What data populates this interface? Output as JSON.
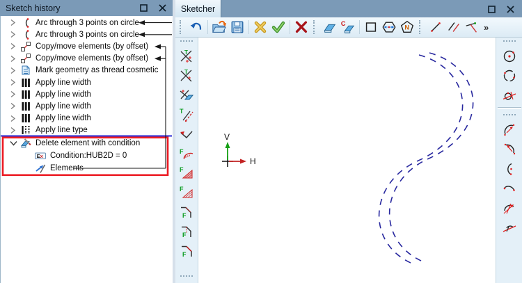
{
  "colors": {
    "titlebar_bg": "#7b9ab7",
    "vtoolbar_bg": "#e4f0f8",
    "highlight_red": "#ec1c24",
    "selection_blue": "#2b2bd5",
    "curve_blue": "#28289f",
    "axis_v_green": "#16a015",
    "axis_h_red": "#c32222"
  },
  "left_panel": {
    "title": "Sketch history",
    "window_buttons": [
      "maximize-icon",
      "close-icon"
    ],
    "tree": {
      "items": [
        {
          "label": "Arc through 3 points on circle",
          "icon": "arc-3-points-icon",
          "state": "collapsed",
          "annotated": true
        },
        {
          "label": "Arc through 3 points on circle",
          "icon": "arc-3-points-icon",
          "state": "collapsed",
          "annotated": true
        },
        {
          "label": "Copy/move elements (by offset)",
          "icon": "copy-move-offset-icon",
          "state": "collapsed",
          "annotated": true
        },
        {
          "label": "Copy/move elements (by offset)",
          "icon": "copy-move-offset-icon",
          "state": "collapsed",
          "annotated": true
        },
        {
          "label": "Mark geometry as thread cosmetic",
          "icon": "thread-cosmetic-icon",
          "state": "collapsed"
        },
        {
          "label": "Apply line width",
          "icon": "line-width-icon",
          "state": "collapsed"
        },
        {
          "label": "Apply line width",
          "icon": "line-width-icon",
          "state": "collapsed"
        },
        {
          "label": "Apply line width",
          "icon": "line-width-icon",
          "state": "collapsed"
        },
        {
          "label": "Apply line width",
          "icon": "line-width-icon",
          "state": "collapsed"
        },
        {
          "label": "Apply line type",
          "icon": "line-type-icon",
          "state": "collapsed"
        },
        {
          "label": "Delete element with condition",
          "icon": "delete-with-condition-icon",
          "state": "expanded",
          "highlighted": true
        },
        {
          "label": "Condition:HUB2D = 0",
          "icon": "expression-icon",
          "child": true
        },
        {
          "label": "Elements",
          "icon": "elements-icon",
          "child": true,
          "annotated": true
        }
      ]
    }
  },
  "sketcher": {
    "tab": "Sketcher",
    "window_buttons": [
      "maximize-icon",
      "close-icon"
    ],
    "toolbar_icons": [
      "undo-icon",
      "open-folder-icon",
      "save-icon",
      "cancel-yellow-icon",
      "confirm-check-icon",
      "delete-red-icon",
      "eraser-icon",
      "eraser-clear-icon",
      "rectangle-icon",
      "hexagon-measure-icon",
      "polygon-n-icon",
      "line-icon",
      "parallel-line-icon",
      "angle-line-icon",
      "more-chevron-icon"
    ],
    "more_label": "»",
    "left_toolbar_icons": [
      "trim-intersect-icon",
      "trim-intersect-alt-icon",
      "trim-delete-icon",
      "offset-line-icon",
      "corner-trim-icon",
      "fillet-arc-icon",
      "fillet-triangle-filled-icon",
      "fillet-triangle-icon",
      "chamfer-dashed-icon",
      "chamfer-dotted-icon",
      "chamfer-solid-icon"
    ],
    "right_toolbar_icons": {
      "circle_group": [
        "circle-center-icon",
        "circle-points-icon",
        "circle-tangent-icon"
      ],
      "arc_group": [
        "arc-center-arrow-icon",
        "arc-center-arrow-alt-icon",
        "arc-center-dot-icon",
        "arc-endpoints-icon",
        "arc-tangent-arrow-icon",
        "arc-tangent-line-icon"
      ]
    },
    "canvas": {
      "axis": {
        "v_label": "V",
        "h_label": "H"
      },
      "curve": {
        "shape": "s-curve",
        "style": "dashed",
        "strands": 2
      }
    }
  }
}
